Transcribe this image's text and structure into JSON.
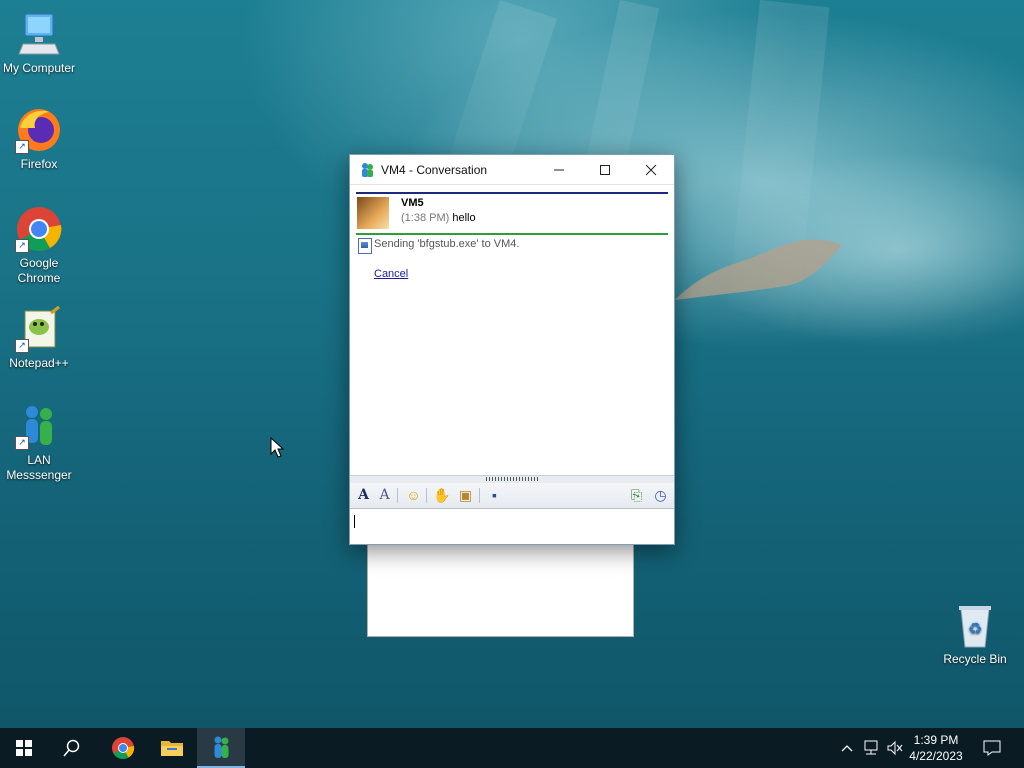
{
  "desktop": {
    "icons": [
      {
        "label": "My Computer",
        "icon": "computer-icon"
      },
      {
        "label": "Firefox",
        "icon": "firefox-icon"
      },
      {
        "label": "Google\nChrome",
        "icon": "chrome-icon"
      },
      {
        "label": "Notepad++",
        "icon": "notepadpp-icon"
      },
      {
        "label": "LAN\nMesssenger",
        "icon": "lan-messenger-icon"
      },
      {
        "label": "Recycle Bin",
        "icon": "recycle-bin-icon"
      }
    ]
  },
  "conversation": {
    "title": "VM4 - Conversation",
    "sender": "VM5",
    "time": "(1:38 PM)",
    "message": "hello",
    "status": "Sending 'bfgstub.exe' to VM4.",
    "cancel_label": "Cancel",
    "input_value": ""
  },
  "toolbar_icons": [
    "font-icon",
    "font-style-icon",
    "emoticon-icon",
    "nudge-icon",
    "contact-icon",
    "save-icon",
    "send-file-icon",
    "history-icon"
  ],
  "taskbar": {
    "items": [
      "start-icon",
      "search-icon",
      "chrome-icon",
      "file-explorer-icon",
      "lan-messenger-icon"
    ],
    "tray_icons": [
      "chevron-up-icon",
      "network-icon",
      "volume-muted-icon"
    ],
    "time": "1:39 PM",
    "date": "4/22/2023"
  },
  "colors": {
    "accent": "#1d2a7c",
    "divider_green": "#2e9e3a",
    "link": "#1a1aa6",
    "taskbar": "#0b1b24"
  }
}
